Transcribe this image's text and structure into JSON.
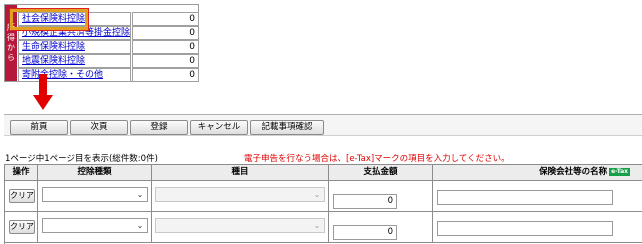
{
  "deductions": {
    "side_label": [
      "所",
      "得",
      "か",
      "ら"
    ],
    "items": [
      {
        "name": "社会保険料控除",
        "amount": "0"
      },
      {
        "name": "小規模企業共済等掛金控除",
        "amount": "0"
      },
      {
        "name": "生命保険料控除",
        "amount": "0"
      },
      {
        "name": "地震保険料控除",
        "amount": "0"
      },
      {
        "name": "寄附金控除・その他",
        "amount": "0"
      }
    ]
  },
  "toolbar": {
    "prev": "前頁",
    "next": "次頁",
    "register": "登録",
    "cancel": "キャンセル",
    "confirm": "記載事項確認"
  },
  "status": {
    "page_info": "1ページ中1ページ目を表示(総件数:0件)",
    "etax_notice": "電子申告を行なう場合は、[e-Tax]マークの項目を入力してください。"
  },
  "grid": {
    "headers": {
      "operation": "操作",
      "deduction_type": "控除種類",
      "item": "種目",
      "amount_paid": "支払金額",
      "company": "保険会社等の名称",
      "etax_badge": "e-Tax"
    },
    "rows": [
      {
        "clear": "クリア",
        "deduction_type": "",
        "item": "",
        "amount": "0",
        "company": ""
      },
      {
        "clear": "クリア",
        "deduction_type": "",
        "item": "",
        "amount": "0",
        "company": ""
      }
    ]
  },
  "colors": {
    "side_label": "#b5183a",
    "highlight": "#e0a020",
    "arrow": "#e00000",
    "etax_badge": "#16a04a"
  }
}
